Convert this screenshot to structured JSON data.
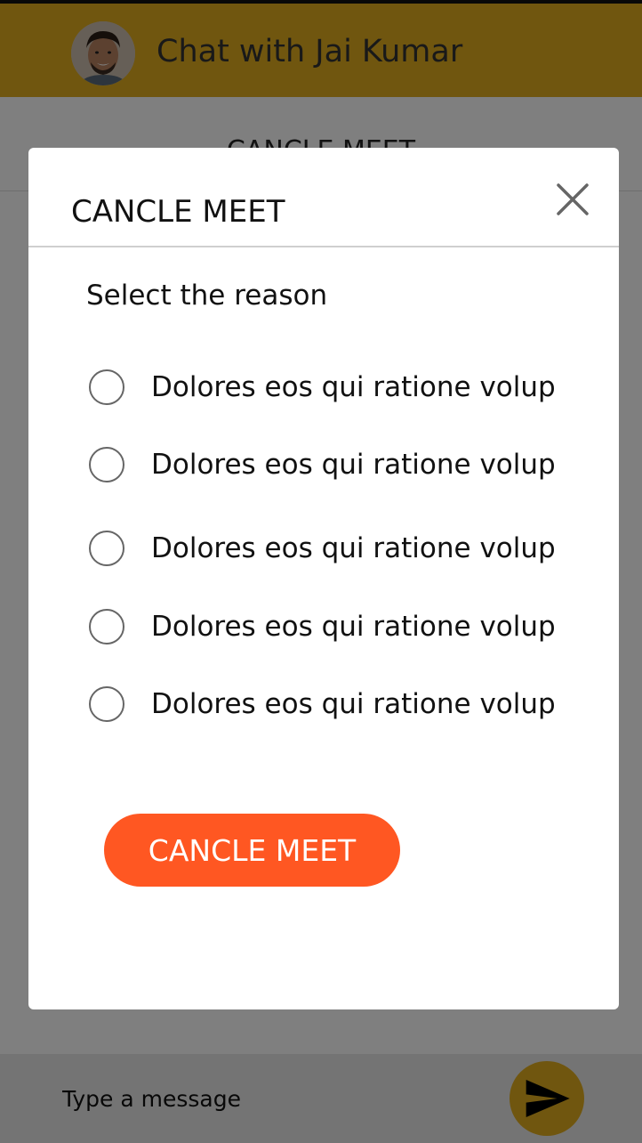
{
  "header": {
    "title": "Chat with Jai Kumar",
    "avatar_icon": "user-avatar"
  },
  "subbar": {
    "label": "CANCLE MEET"
  },
  "composer": {
    "placeholder": "Type a message",
    "send_icon": "send-icon"
  },
  "modal": {
    "title": "CANCLE MEET",
    "close_icon": "close-icon",
    "reason_heading": "Select the reason",
    "reasons": [
      {
        "label": "Dolores eos qui ratione volup",
        "selected": false
      },
      {
        "label": "Dolores eos qui ratione volup",
        "selected": false
      },
      {
        "label": "Dolores eos qui ratione volup",
        "selected": false
      },
      {
        "label": "Dolores eos qui ratione volup",
        "selected": false
      },
      {
        "label": "Dolores eos qui ratione volup",
        "selected": false
      }
    ],
    "submit_label": "CANCLE MEET"
  },
  "colors": {
    "brand": "#e0ac1e",
    "accent": "#ff5722"
  }
}
